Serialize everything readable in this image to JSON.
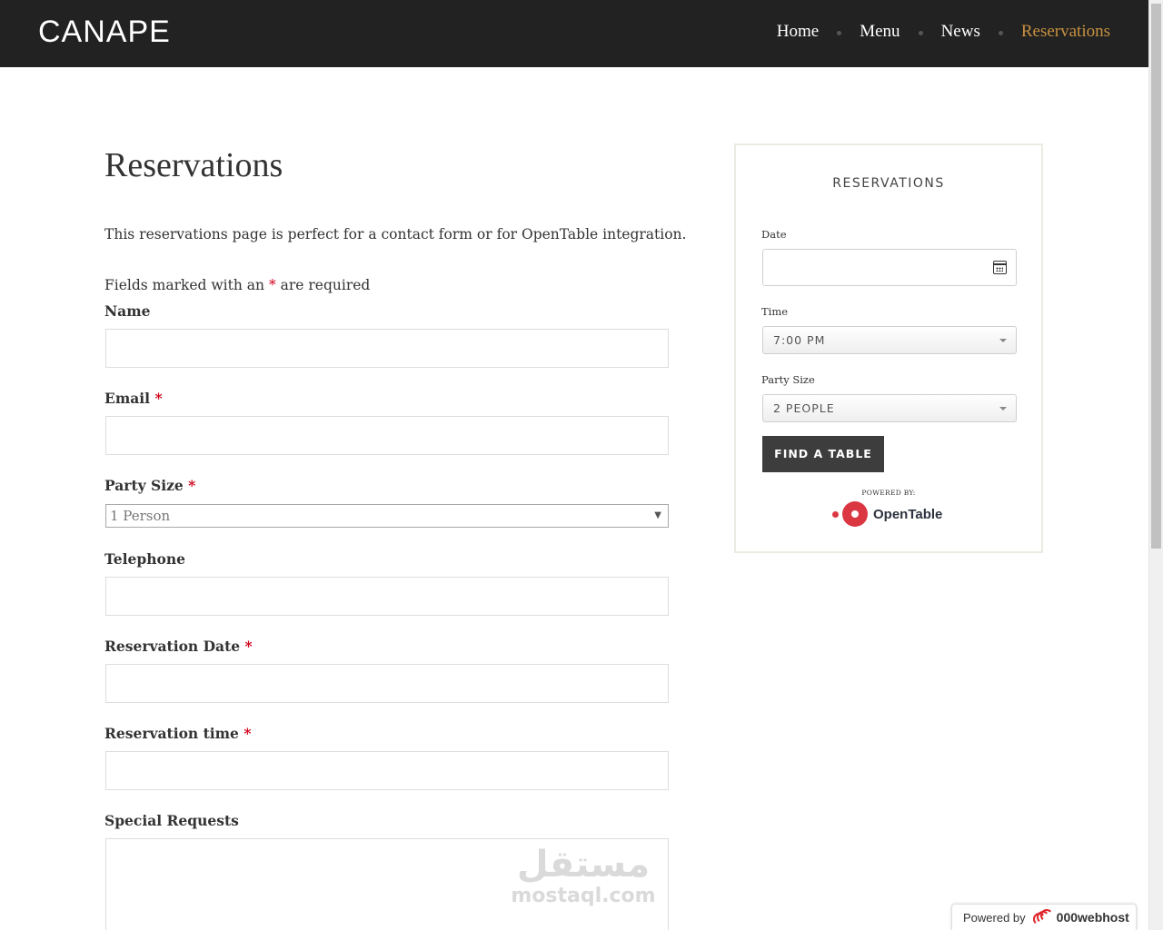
{
  "header": {
    "logo": "CANAPE",
    "nav": [
      {
        "label": "Home"
      },
      {
        "label": "Menu"
      },
      {
        "label": "News"
      },
      {
        "label": "Reservations"
      }
    ]
  },
  "main": {
    "title": "Reservations",
    "intro": "This reservations page is perfect for a contact form or for OpenTable integration.",
    "required_note_pre": "Fields marked with an",
    "required_star": "*",
    "required_note_post": "are required",
    "fields": {
      "name_label": "Name",
      "email_label": "Email",
      "party_label": "Party Size",
      "party_value": "1 Person",
      "telephone_label": "Telephone",
      "res_date_label": "Reservation Date",
      "res_time_label": "Reservation time",
      "special_label": "Special Requests"
    }
  },
  "widget": {
    "title": "RESERVATIONS",
    "date_label": "Date",
    "time_label": "Time",
    "time_value": "7:00 PM",
    "party_label": "Party Size",
    "party_value": "2 PEOPLE",
    "button": "FIND A TABLE",
    "powered_by": "POWERED BY:",
    "opentable": "OpenTable",
    "opentable_mark": "·"
  },
  "watermark": {
    "arabic": "مستقل",
    "latin": "mostaql.com"
  },
  "badge": {
    "text": "Powered by",
    "brand": "000webhost"
  },
  "colors": {
    "header_bg": "#222222",
    "accent": "#c8913f",
    "required": "#d0021b",
    "button_bg": "#3d3d3d",
    "opentable_red": "#da3743"
  }
}
